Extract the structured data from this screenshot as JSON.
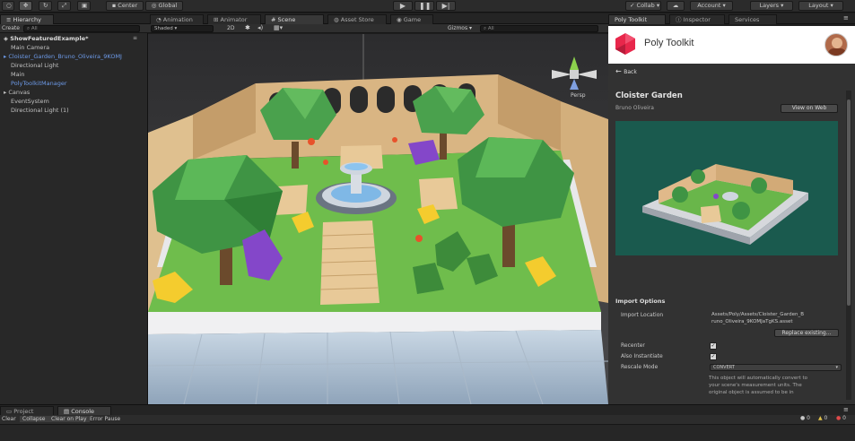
{
  "toolbar": {
    "pivot": "Center",
    "space": "Global",
    "collab": "Collab",
    "account": "Account",
    "layers": "Layers",
    "layout": "Layout",
    "play_icon": "play-icon",
    "pause_icon": "pause-icon",
    "step_icon": "step-icon"
  },
  "hierarchy": {
    "tab": "Hierarchy",
    "create": "Create",
    "search_placeholder": "All",
    "items": [
      {
        "label": "ShowFeaturedExample*",
        "indent": 0
      },
      {
        "label": "Main Camera",
        "indent": 1
      },
      {
        "label": "Cloister_Garden_Bruno_Oliveira_9KOMJ",
        "indent": 1
      },
      {
        "label": "Directional Light",
        "indent": 1
      },
      {
        "label": "Main",
        "indent": 1
      },
      {
        "label": "PolyToolkitManager",
        "indent": 1
      },
      {
        "label": "Canvas",
        "indent": 1
      },
      {
        "label": "EventSystem",
        "indent": 1
      },
      {
        "label": "Directional Light (1)",
        "indent": 1
      }
    ]
  },
  "center_tabs": {
    "animation": "Animation",
    "animator": "Animator",
    "scene": "Scene",
    "asset_store": "Asset Store",
    "game": "Game"
  },
  "scene": {
    "shading": "Shaded",
    "mode_2d": "2D",
    "gizmos": "Gizmos",
    "search_placeholder": "All",
    "persp": "Persp"
  },
  "right_tabs": {
    "poly": "Poly Toolkit",
    "inspector": "Inspector",
    "services": "Services"
  },
  "poly": {
    "brand": "Poly Toolkit",
    "back": "Back",
    "title": "Cloister Garden",
    "author": "Bruno Oliveira",
    "view_on_web": "View on Web",
    "import_options": "Import Options",
    "import_location_label": "Import Location",
    "import_location_value_1": "Assets/Poly/Assets/Cloister_Garden_B",
    "import_location_value_2": "runo_Oliveira_9KOMJaTgKS.asset",
    "replace_existing": "Replace existing...",
    "recenter_label": "Recenter",
    "recenter_checked": true,
    "instantiate_label": "Also Instantiate",
    "instantiate_checked": true,
    "rescale_label": "Rescale Mode",
    "rescale_value": "CONVERT",
    "note_1": "This object will automatically convert to",
    "note_2": "your scene's measurement units. The",
    "note_3": "original object is assumed to be in"
  },
  "bottom": {
    "project": "Project",
    "console": "Console",
    "clear": "Clear",
    "collapse": "Collapse",
    "clear_on_play": "Clear on Play",
    "error_pause": "Error Pause",
    "counts": [
      "0",
      "0",
      "0"
    ]
  },
  "colors": {
    "brand": "#e8274b",
    "selection_blue": "#6d9ae8",
    "preview_bg": "#1a5a4e"
  }
}
